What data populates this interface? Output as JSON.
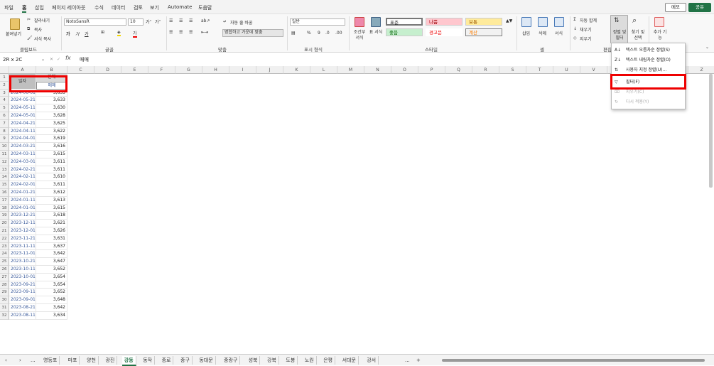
{
  "menu": {
    "items": [
      "파일",
      "홈",
      "삽입",
      "페이지 레이아웃",
      "수식",
      "데이터",
      "검토",
      "보기",
      "Automate",
      "도움말"
    ],
    "memo": "메모",
    "share": "공유"
  },
  "ribbon": {
    "clipboard": {
      "paste": "붙여넣기",
      "cut": "잘라내기",
      "copy": "복사",
      "format_painter": "서식 복사",
      "label": "클립보드"
    },
    "font": {
      "name": "NotoSansR",
      "size": "10",
      "label": "글꼴"
    },
    "align": {
      "wrap": "자동 줄 바꿈",
      "merge": "병합하고 가운데 맞춤",
      "label": "맞춤"
    },
    "number": {
      "format": "일반",
      "label": "표시 형식"
    },
    "styles": {
      "conditional": "조건부 서식",
      "table": "표 서식",
      "s1": "표준",
      "s2": "나쁨",
      "s3": "보통",
      "s4": "좋음",
      "s5": "경고문",
      "s6": "계산",
      "label": "스타일"
    },
    "cells": {
      "insert": "삽입",
      "delete": "삭제",
      "format": "서식",
      "label": "셀"
    },
    "editing": {
      "autosum": "자동 합계",
      "fill": "채우기",
      "clear": "지우기",
      "sort_filter": "정렬 및 필터",
      "find": "찾기 및 선택",
      "label": "편집"
    },
    "addins": {
      "label": "추가 기능"
    }
  },
  "formula_bar": {
    "name_box": "2R x 2C",
    "fx": "fx",
    "value": "매매"
  },
  "columns": [
    "A",
    "B",
    "C",
    "D",
    "E",
    "F",
    "G",
    "H",
    "I",
    "J",
    "K",
    "L",
    "M",
    "N",
    "O",
    "P",
    "Q",
    "R",
    "S",
    "T",
    "U",
    "V",
    "W",
    "X",
    "Y",
    "Z"
  ],
  "header": {
    "a1": "일자",
    "b1": "전체",
    "b2": "매매"
  },
  "rows": [
    [
      "2024-06-01",
      "3,635"
    ],
    [
      "2024-05-21",
      "3,633"
    ],
    [
      "2024-05-11",
      "3,630"
    ],
    [
      "2024-05-01",
      "3,628"
    ],
    [
      "2024-04-21",
      "3,625"
    ],
    [
      "2024-04-11",
      "3,622"
    ],
    [
      "2024-04-01",
      "3,619"
    ],
    [
      "2024-03-21",
      "3,616"
    ],
    [
      "2024-03-11",
      "3,615"
    ],
    [
      "2024-03-01",
      "3,611"
    ],
    [
      "2024-02-21",
      "3,611"
    ],
    [
      "2024-02-11",
      "3,610"
    ],
    [
      "2024-02-01",
      "3,611"
    ],
    [
      "2024-01-21",
      "3,612"
    ],
    [
      "2024-01-11",
      "3,613"
    ],
    [
      "2024-01-01",
      "3,615"
    ],
    [
      "2023-12-21",
      "3,618"
    ],
    [
      "2023-12-11",
      "3,621"
    ],
    [
      "2023-12-01",
      "3,626"
    ],
    [
      "2023-11-21",
      "3,631"
    ],
    [
      "2023-11-11",
      "3,637"
    ],
    [
      "2023-11-01",
      "3,642"
    ],
    [
      "2023-10-21",
      "3,647"
    ],
    [
      "2023-10-11",
      "3,652"
    ],
    [
      "2023-10-01",
      "3,654"
    ],
    [
      "2023-09-21",
      "3,654"
    ],
    [
      "2023-09-11",
      "3,652"
    ],
    [
      "2023-09-01",
      "3,648"
    ],
    [
      "2023-08-21",
      "3,642"
    ],
    [
      "2023-08-11",
      "3,634"
    ]
  ],
  "dropdown": {
    "items": [
      "텍스트 오름차순 정렬(S)",
      "텍스트 내림차순 정렬(O)",
      "사용자 지정 정렬(U)...",
      "필터(F)",
      "지우기(C)",
      "다시 적용(Y)"
    ]
  },
  "sheets": {
    "nav_prev": "‹",
    "nav_next": "›",
    "more": "...",
    "tabs": [
      "영등포",
      "마포",
      "양천",
      "광진",
      "강동",
      "동작",
      "종로",
      "중구",
      "동대문",
      "중랑구",
      "성북",
      "강북",
      "도봉",
      "노원",
      "은평",
      "서대문",
      "강서"
    ],
    "active": "강동",
    "add": "+"
  }
}
